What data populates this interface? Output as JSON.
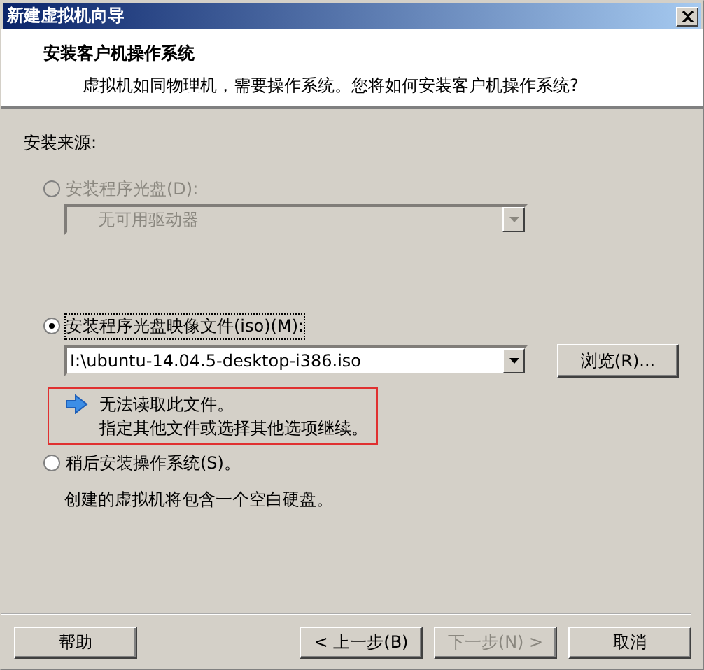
{
  "window": {
    "title": "新建虚拟机向导"
  },
  "header": {
    "title": "安装客户机操作系统",
    "subtitle": "虚拟机如同物理机，需要操作系统。您将如何安装客户机操作系统?"
  },
  "source_label": "安装来源:",
  "disc_option": {
    "label": "安装程序光盘(D):",
    "selected": false,
    "disabled": true
  },
  "disc_dropdown": {
    "value": "无可用驱动器",
    "disabled": true
  },
  "iso_option": {
    "label": "安装程序光盘映像文件(iso)(M):",
    "selected": true,
    "disabled": false
  },
  "iso_combo": {
    "value": "I:\\ubuntu-14.04.5-desktop-i386.iso"
  },
  "browse_button": {
    "label": "浏览(R)..."
  },
  "message": {
    "lines": [
      "无法读取此文件。",
      "指定其他文件或选择其他选项继续。"
    ]
  },
  "later_option": {
    "label": "稍后安装操作系统(S)。",
    "selected": false,
    "disabled": false
  },
  "later_note": "创建的虚拟机将包含一个空白硬盘。",
  "buttons": [
    {
      "label": "帮助",
      "disabled": false,
      "kind": "left"
    },
    {
      "label": "< 上一步(B)",
      "disabled": false,
      "kind": "right"
    },
    {
      "label": "下一步(N) >",
      "disabled": true,
      "kind": "right"
    },
    {
      "label": "取消",
      "disabled": false,
      "kind": "right"
    }
  ]
}
